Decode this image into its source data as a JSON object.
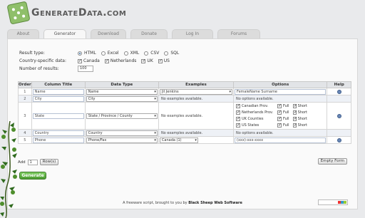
{
  "header": {
    "logo_text": "GenerateData.com"
  },
  "tabs": [
    {
      "label": "About",
      "active": false
    },
    {
      "label": "Generator",
      "active": true
    },
    {
      "label": "Download",
      "active": false
    },
    {
      "label": "Donate",
      "active": false
    },
    {
      "label": "Log In",
      "active": false
    },
    {
      "label": "Forums",
      "active": false
    }
  ],
  "options": {
    "result_type_label": "Result type:",
    "result_types": [
      "HTML",
      "Excel",
      "XML",
      "CSV",
      "SQL"
    ],
    "selected_result_type": "HTML",
    "country_label": "Country-specific data:",
    "countries": [
      "Canada",
      "Netherlands",
      "UK",
      "US"
    ],
    "num_results_label": "Number of results:",
    "num_results": "100"
  },
  "table": {
    "headers": [
      "Order",
      "Column Title",
      "Data Type",
      "Examples",
      "Options",
      "Help"
    ],
    "rows": [
      {
        "order": "1",
        "title": "Name",
        "type": "Name",
        "example": "Jil Jenkins",
        "options": "FemaleName Surname"
      },
      {
        "order": "2",
        "title": "City",
        "type": "City",
        "example": "No examples available.",
        "options": "No options available."
      },
      {
        "order": "3",
        "title": "State",
        "type": "State / Province / County",
        "example": "No examples available.",
        "region_options": [
          {
            "name": "Canadian Prov.",
            "full": "Full",
            "short": "Short"
          },
          {
            "name": "Netherlands Prov.",
            "full": "Full",
            "short": "Short"
          },
          {
            "name": "UK Counties",
            "full": "Full",
            "short": "Short"
          },
          {
            "name": "US States",
            "full": "Full",
            "short": "Short"
          }
        ]
      },
      {
        "order": "4",
        "title": "Country",
        "type": "Country",
        "example": "No examples available.",
        "options": "No options available."
      },
      {
        "order": "5",
        "title": "Phone",
        "type": "Phone/Fax",
        "example": "Canada (1)",
        "options": "(xxx)-xxx-xxxx"
      }
    ]
  },
  "controls": {
    "add_label": "Add",
    "add_count": "1",
    "rows_button": "Row(s)",
    "empty_form_button": "Empty Form",
    "generate_button": "Generate"
  },
  "footer": {
    "prefix": "A freeware script, brought to you by ",
    "company": "Black Sheep Web Software"
  }
}
